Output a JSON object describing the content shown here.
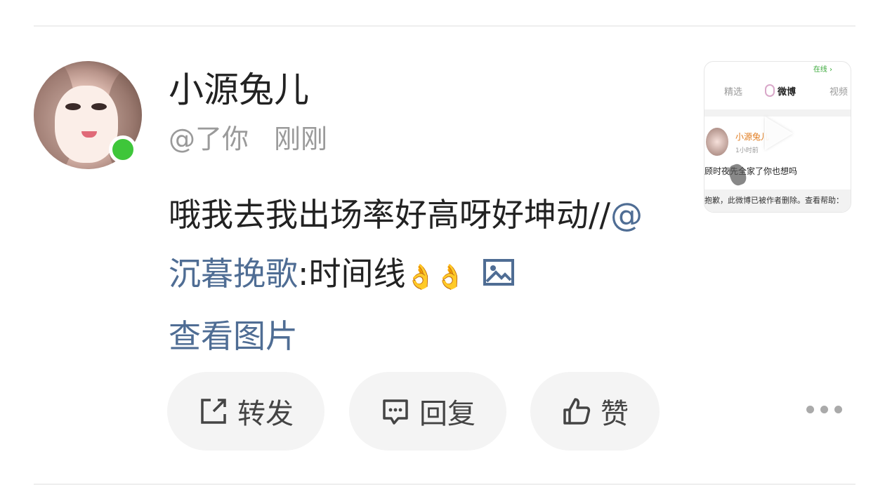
{
  "post": {
    "author": "小源兔儿",
    "handle": "@了你",
    "time": "刚刚",
    "text_before": "哦我去我出场率好高呀好坤动//",
    "mention": "@沉暮挽歌",
    "text_after": ":时间线",
    "emoji": "👌👌",
    "image_link": "查看图片",
    "online_color": "#3ec63a",
    "link_color": "#4f6d94"
  },
  "actions": {
    "repost_label": "转发",
    "reply_label": "回复",
    "like_label": "赞"
  },
  "thumbnail": {
    "status": "在线 ›",
    "tab_left": "精选",
    "tab_center": "微博",
    "tab_right": "视频",
    "mini_author": "小源兔儿",
    "mini_time": "1小时前",
    "mini_text": "顾时夜先全家了你也想吗",
    "deleted_notice": "抱歉，此微博已被作者删除。查看帮助："
  }
}
